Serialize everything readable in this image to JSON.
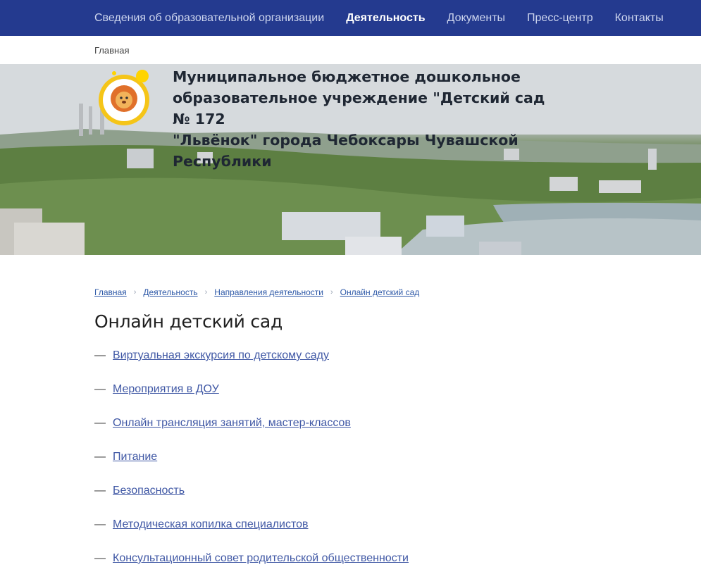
{
  "nav": {
    "items": [
      {
        "label": "Сведения об образовательной организации",
        "active": false
      },
      {
        "label": "Деятельность",
        "active": true
      },
      {
        "label": "Документы",
        "active": false
      },
      {
        "label": "Пресс-центр",
        "active": false
      },
      {
        "label": "Контакты",
        "active": false
      }
    ]
  },
  "subbar": {
    "home_label": "Главная"
  },
  "header": {
    "title_line1": "Муниципальное бюджетное дошкольное",
    "title_line2": "образовательное учреждение \"Детский сад № 172",
    "title_line3": "\"Львёнок\" города Чебоксары Чувашской Республики"
  },
  "breadcrumb": [
    {
      "label": "Главная"
    },
    {
      "label": "Деятельность"
    },
    {
      "label": "Направления деятельности"
    },
    {
      "label": "Онлайн детский сад"
    }
  ],
  "page": {
    "title": "Онлайн детский сад",
    "dash": "—",
    "links": [
      {
        "label": "Виртуальная экскурсия по детскому саду"
      },
      {
        "label": "Мероприятия в ДОУ"
      },
      {
        "label": "Онлайн трансляция занятий, мастер-классов"
      },
      {
        "label": "Питание"
      },
      {
        "label": "Безопасность"
      },
      {
        "label": "Методическая копилка специалистов"
      },
      {
        "label": "Консультационный совет родительской общественности"
      }
    ]
  },
  "colors": {
    "nav_bg": "#243a8f",
    "link": "#4058a5",
    "crumb_link": "#2f5aa8"
  }
}
